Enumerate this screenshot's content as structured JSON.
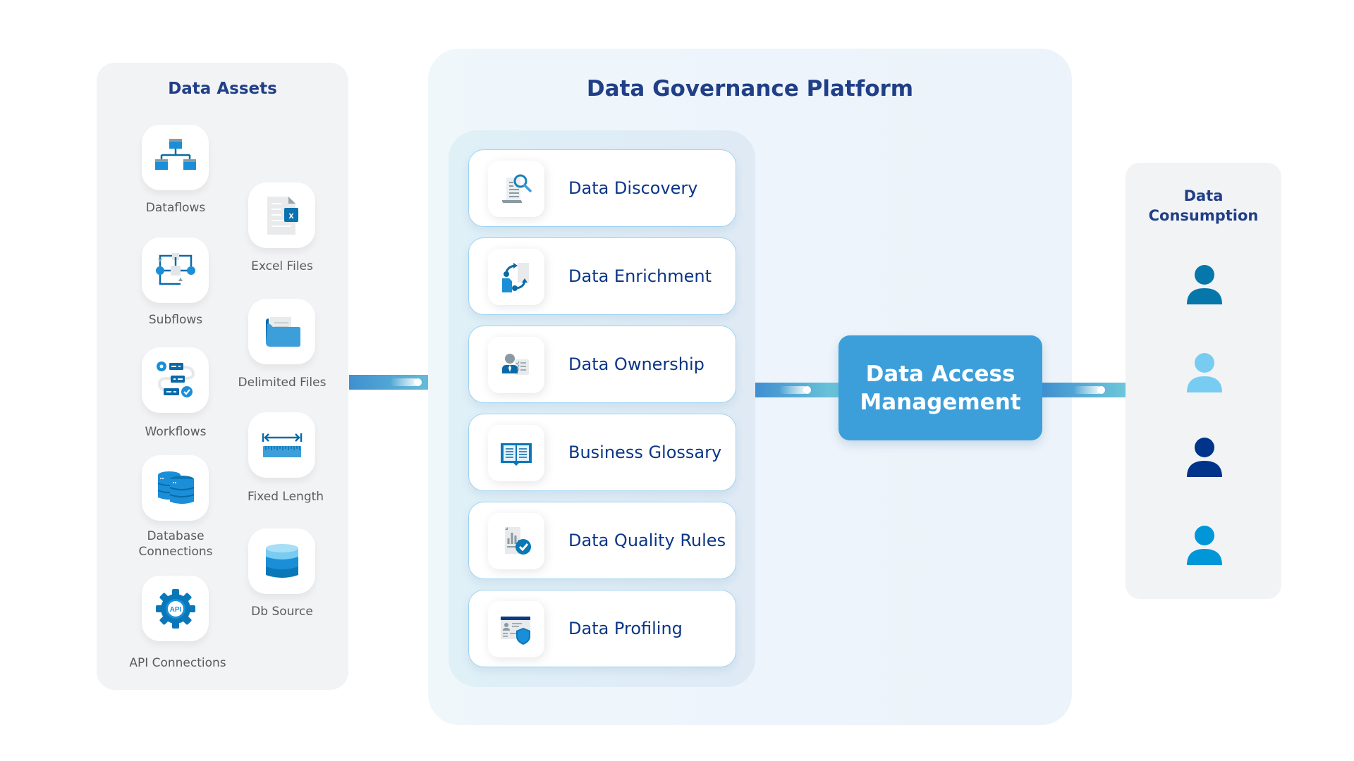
{
  "assets": {
    "title": "Data Assets",
    "items": [
      {
        "label": "Dataflows",
        "icon": "dataflow-icon"
      },
      {
        "label": "Excel Files",
        "icon": "excel-file-icon"
      },
      {
        "label": "Subflows",
        "icon": "subflow-icon"
      },
      {
        "label": "Delimited Files",
        "icon": "folder-icon"
      },
      {
        "label": "Workflows",
        "icon": "workflow-icon"
      },
      {
        "label": "Fixed Length",
        "icon": "ruler-icon"
      },
      {
        "label": "Database Connections",
        "icon": "database-connections-icon"
      },
      {
        "label": "Db Source",
        "icon": "database-icon"
      },
      {
        "label": "API Connections",
        "icon": "api-gear-icon"
      }
    ]
  },
  "platform": {
    "title": "Data Governance Platform",
    "modules": [
      {
        "label": "Data Discovery",
        "icon": "document-search-icon"
      },
      {
        "label": "Data Enrichment",
        "icon": "data-sync-icon"
      },
      {
        "label": "Data Ownership",
        "icon": "owner-checklist-icon"
      },
      {
        "label": "Business Glossary",
        "icon": "open-book-icon"
      },
      {
        "label": "Data Quality Rules",
        "icon": "chart-check-icon"
      },
      {
        "label": "Data Profiling",
        "icon": "profile-shield-icon"
      }
    ],
    "access_management": "Data Access Management"
  },
  "consumption": {
    "title": "Data Consumption",
    "users": [
      {
        "icon": "user-icon",
        "color": "#0677ab"
      },
      {
        "icon": "user-icon",
        "color": "#78ccf2"
      },
      {
        "icon": "user-icon",
        "color": "#00348a"
      },
      {
        "icon": "user-icon",
        "color": "#0096d8"
      }
    ]
  },
  "colors": {
    "title": "#213f87",
    "accent": "#3c9fda",
    "card_text": "#0b3687"
  }
}
